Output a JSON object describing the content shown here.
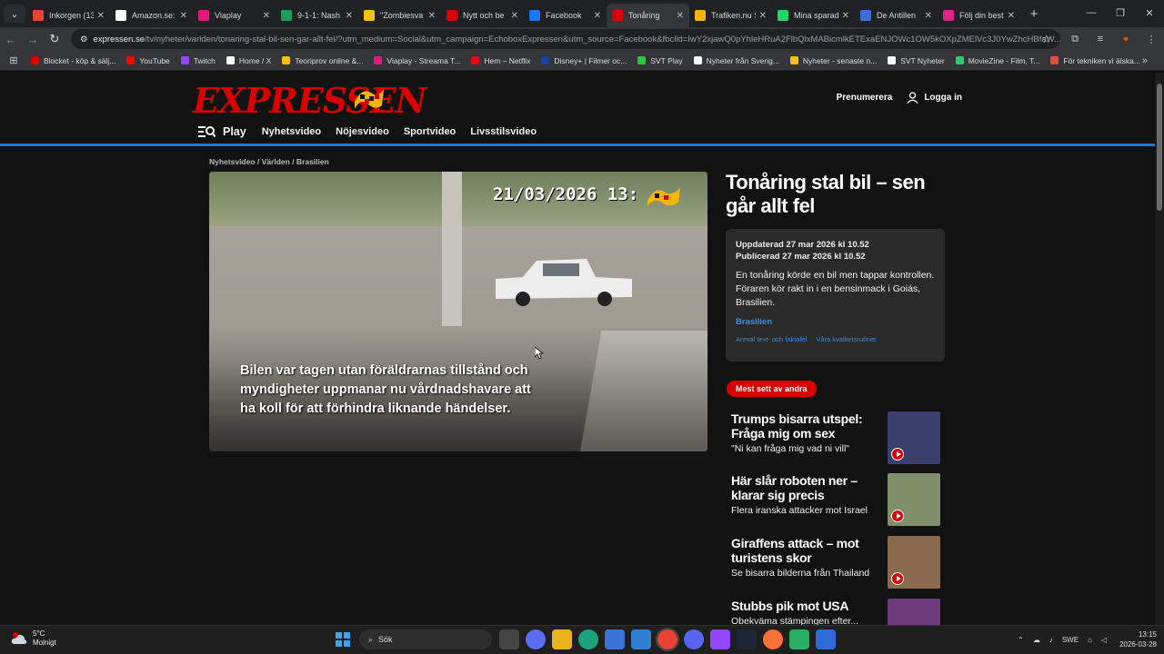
{
  "browser": {
    "tabs": [
      {
        "label": "Inkorgen (13",
        "color": "#ea4335"
      },
      {
        "label": "Amazon.se:",
        "color": "#ffffff"
      },
      {
        "label": "Viaplay",
        "color": "#e8177d"
      },
      {
        "label": "9-1-1: Nash",
        "color": "#1e9e5a"
      },
      {
        "label": "\"Zombiesva",
        "color": "#f4c20d"
      },
      {
        "label": "Nytt och be",
        "color": "#d80000"
      },
      {
        "label": "Facebook",
        "color": "#1877f2"
      },
      {
        "label": "Tonåring",
        "color": "#d80000",
        "active": true
      },
      {
        "label": "Trafiken.nu S",
        "color": "#f4b400"
      },
      {
        "label": "Mina sparad",
        "color": "#25d366"
      },
      {
        "label": "De Antillen",
        "color": "#3b6fd8"
      },
      {
        "label": "Följ din best",
        "color": "#e0218a"
      }
    ],
    "url_host": "expressen.se",
    "url_path": "/tv/nyheter/varlden/tonaring-stal-bil-sen-gar-allt-fel/?utm_medium=Social&utm_campaign=EchoboxExpressen&utm_source=Facebook&fbclid=IwY2xjawQ0pYhleHRuA2FlbQlxMABicmlkETExaENJOWc1OW5kOXpZMElVc3J0YwZhcHBfaW...",
    "bookmarks": [
      {
        "label": "Blocket - köp & sälj...",
        "color": "#d80000"
      },
      {
        "label": "YouTube",
        "color": "#ff0000"
      },
      {
        "label": "Twitch",
        "color": "#9146ff"
      },
      {
        "label": "Home / X",
        "color": "#ffffff"
      },
      {
        "label": "Teoriprov online &...",
        "color": "#f4c20d"
      },
      {
        "label": "Viaplay - Streama T...",
        "color": "#e8177d"
      },
      {
        "label": "Hem – Netflix",
        "color": "#e50914"
      },
      {
        "label": "Disney+ | Filmer oc...",
        "color": "#1a3fa8"
      },
      {
        "label": "SVT Play",
        "color": "#27c93f"
      },
      {
        "label": "Nyheter från Sverig...",
        "color": "#ffffff"
      },
      {
        "label": "Nyheter - senaste n...",
        "color": "#f4c20d"
      },
      {
        "label": "SVT Nyheter",
        "color": "#ffffff"
      },
      {
        "label": "MovieZine - Film, T...",
        "color": "#2ecc71"
      },
      {
        "label": "För tekniken vi älska...",
        "color": "#e74c3c"
      }
    ]
  },
  "site": {
    "logo": "EXPRESSEN",
    "subscribe": "Prenumerera",
    "login": "Logga in",
    "nav": {
      "play": "Play",
      "items": [
        "Nyhetsvideo",
        "Nöjesvideo",
        "Sportvideo",
        "Livsstilsvideo"
      ]
    },
    "breadcrumb": "Nyhetsvideo / Världen / Brasilien"
  },
  "video": {
    "timestamp": "21/03/2026 13:",
    "caption": "Bilen var tagen utan föräldrarnas tillstånd och myndigheter uppmanar nu vårdnadshavare att ha koll för att förhindra liknande händelser."
  },
  "article": {
    "headline": "Tonåring stal bil – sen går allt fel",
    "updated": "Uppdaterad 27 mar 2026 kl 10.52",
    "published": "Publicerad 27 mar 2026 kl 10.52",
    "description": "En tonåring körde en bil men tappar kontrollen. Föraren kör rakt in i en bensinmack i Goiás, Brasilien.",
    "tag": "Brasilien",
    "link1": "Anmäl text- och faktafel",
    "link2": "Våra kvalitetsrutiner"
  },
  "most_seen": {
    "label": "Mest sett av andra",
    "items": [
      {
        "title": "Trumps bisarra utspel: Fråga mig om sex",
        "subtitle": "\"Ni kan fråga mig vad ni vill\"",
        "thumb": "#3a3f6e"
      },
      {
        "title": "Här slår roboten ner – klarar sig precis",
        "subtitle": "Flera iranska attacker mot Israel",
        "thumb": "#7f8f6a"
      },
      {
        "title": "Giraffens attack – mot turistens skor",
        "subtitle": "Se bisarra bilderna från Thailand",
        "thumb": "#8a6a4f"
      },
      {
        "title": "Stubbs pik mot USA",
        "subtitle": "Obekväma stämpingen efter...",
        "thumb": "#6b3a7a"
      }
    ]
  },
  "taskbar": {
    "weather_temp": "5°C",
    "weather_desc": "Molnigt",
    "weather_badge": "1",
    "search": "Sök",
    "lang": "SWE",
    "time": "13:15",
    "date": "2026-03-28"
  }
}
